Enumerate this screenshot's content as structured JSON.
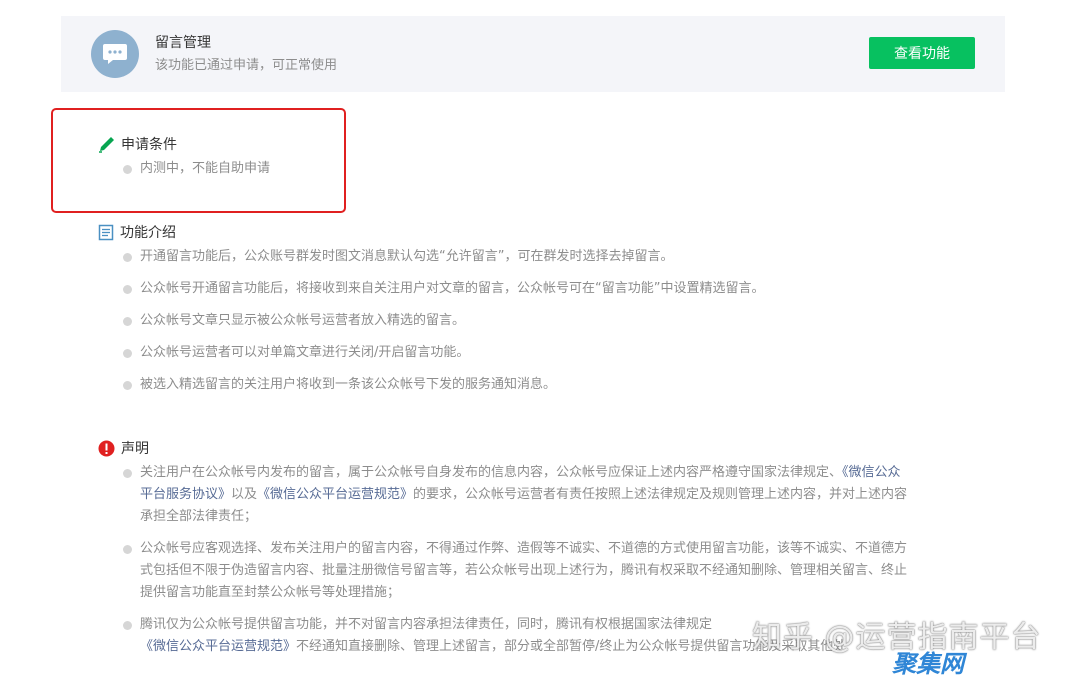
{
  "feature": {
    "title": "留言管理",
    "status": "该功能已通过申请，可正常使用",
    "button_label": "查看功能",
    "avatar_icon": "chat-bubble-icon",
    "avatar_color": "#8eb1cf",
    "button_color": "#07c160"
  },
  "conditions": {
    "heading": "申请条件",
    "icon": "pen-icon",
    "items": [
      "内测中，不能自助申请"
    ]
  },
  "intro": {
    "heading": "功能介绍",
    "icon": "document-icon",
    "items": [
      "开通留言功能后，公众账号群发时图文消息默认勾选“允许留言”，可在群发时选择去掉留言。",
      "公众帐号开通留言功能后，将接收到来自关注用户对文章的留言，公众帐号可在“留言功能”中设置精选留言。",
      "公众帐号文章只显示被公众帐号运营者放入精选的留言。",
      "公众帐号运营者可以对单篇文章进行关闭/开启留言功能。",
      "被选入精选留言的关注用户将收到一条该公众帐号下发的服务通知消息。"
    ]
  },
  "statement": {
    "heading": "声明",
    "icon": "exclamation-icon",
    "p1": {
      "l1_text": "关注用户在公众帐号内发布的留言，属于公众帐号自身发布的信息内容，公众帐号应保证上述内容严格遵守国家法律规定、",
      "l1_link": "《微信公众",
      "l2_link_a": "平台服务协议》",
      "l2_mid": "以及",
      "l2_link_b": "《微信公众平台运营规范》",
      "l2_text": "的要求，公众帐号运营者有责任按照上述法律规定及规则管理上述内容，并对上述内容",
      "l3_text": "承担全部法律责任；"
    },
    "p2": {
      "l1": "公众帐号应客观选择、发布关注用户的留言内容，不得通过作弊、造假等不诚实、不道德的方式使用留言功能，该等不诚实、不道德方",
      "l2": "式包括但不限于伪造留言内容、批量注册微信号留言等，若公众帐号出现上述行为，腾讯有权采取不经通知删除、管理相关留言、终止",
      "l3": "提供留言功能直至封禁公众帐号等处理措施；"
    },
    "p3": {
      "l1_text": "腾讯仅为公众帐号提供留言功能，并不对留言内容承担法律责任，同时，腾讯有权根据国家法律规定",
      "l2_link": "《微信公众平台运营规范》",
      "l2_text": "不经通知直接删除、管理上述留言，部分或全部暂停/终止为公众帐号提供留言功能及采取其他处"
    }
  },
  "watermark": {
    "text": "知乎 @运营指南平台",
    "logo": "聚集网"
  },
  "colors": {
    "highlight_border": "#e02020",
    "link": "#576b95",
    "pen_icon": "#07a550",
    "doc_icon": "#4a90c2",
    "exclamation_icon": "#e02020"
  }
}
